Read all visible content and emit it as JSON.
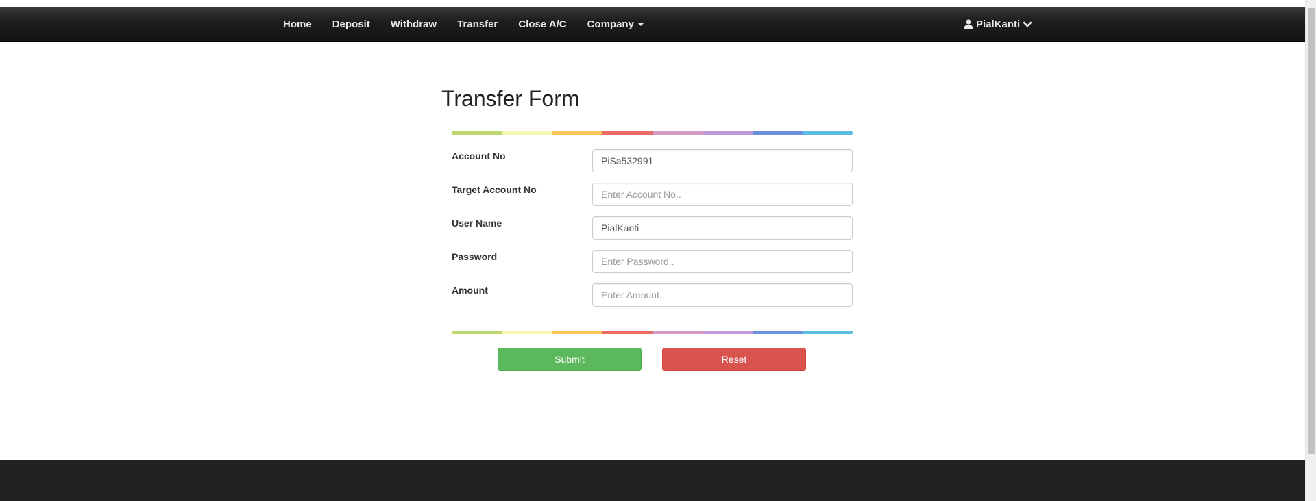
{
  "navbar": {
    "items": [
      {
        "label": "Home"
      },
      {
        "label": "Deposit"
      },
      {
        "label": "Withdraw"
      },
      {
        "label": "Transfer"
      },
      {
        "label": "Close A/C"
      },
      {
        "label": "Company",
        "dropdown": true
      }
    ],
    "user": {
      "name": "PialKanti",
      "icon": "user-icon",
      "chevron": "chevron-down-icon"
    }
  },
  "form": {
    "title": "Transfer Form",
    "fields": [
      {
        "label": "Account No",
        "value": "PiSa532991",
        "placeholder": ""
      },
      {
        "label": "Target Account No",
        "value": "",
        "placeholder": "Enter Account No.."
      },
      {
        "label": "User Name",
        "value": "PialKanti",
        "placeholder": ""
      },
      {
        "label": "Password",
        "value": "",
        "placeholder": "Enter Password.."
      },
      {
        "label": "Amount",
        "value": "",
        "placeholder": "Enter Amount.."
      }
    ],
    "submit_label": "Submit",
    "reset_label": "Reset"
  },
  "colors": {
    "navbar": "#1e1e1e",
    "submit": "#5cb85c",
    "reset": "#d9534f",
    "footer": "#222222",
    "divider": [
      "#bcd86f",
      "#f6f8b0",
      "#f9c55a",
      "#ea6c62",
      "#d49ac6",
      "#c499d8",
      "#6a8fdc",
      "#5bbde4"
    ]
  }
}
